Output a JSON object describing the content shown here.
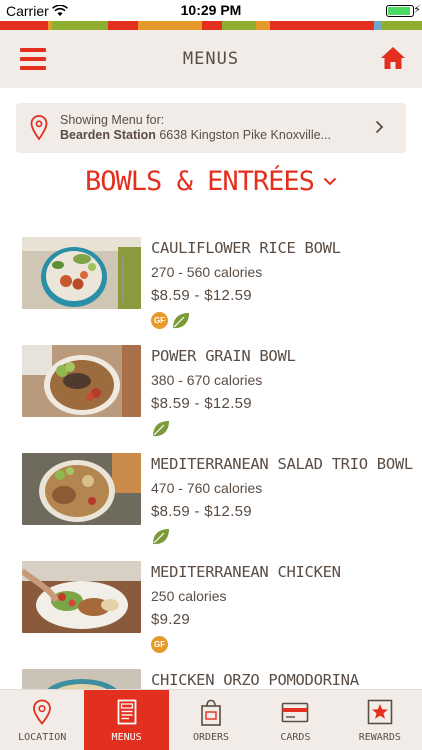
{
  "status_bar": {
    "carrier": "Carrier",
    "time": "10:29 PM",
    "battery_level": 0.9
  },
  "stripe_colors": [
    "#e3301e",
    "#e79a2c",
    "#8fae2f",
    "#e3301e",
    "#e79a2c",
    "#e3301e",
    "#8fae2f",
    "#e79a2c",
    "#e3301e",
    "#6fa9c9",
    "#8fae2f"
  ],
  "header": {
    "title": "MENUS"
  },
  "location": {
    "prefix": "Showing Menu for:",
    "name": "Bearden Station",
    "address": "6638 Kingston Pike Knoxville..."
  },
  "category": {
    "title": "BOWLS & ENTRÉES"
  },
  "items": [
    {
      "name": "CAULIFLOWER RICE BOWL",
      "calories": "270 - 560 calories",
      "price": "$8.59 - $12.59",
      "gf": "GF"
    },
    {
      "name": "POWER GRAIN BOWL",
      "calories": "380 - 670 calories",
      "price": "$8.59 - $12.59"
    },
    {
      "name": "MEDITERRANEAN SALAD TRIO BOWL",
      "calories": "470 - 760 calories",
      "price": "$8.59 - $12.59"
    },
    {
      "name": "MEDITERRANEAN CHICKEN",
      "calories": "250 calories",
      "price": "$9.29",
      "gf": "GF"
    },
    {
      "name": "CHICKEN ORZO POMODORINA"
    }
  ],
  "tabs": [
    {
      "label": "LOCATION",
      "icon": "location-pin-icon"
    },
    {
      "label": "MENUS",
      "icon": "menu-document-icon",
      "active": true
    },
    {
      "label": "ORDERS",
      "icon": "shopping-bag-icon"
    },
    {
      "label": "CARDS",
      "icon": "gift-card-icon"
    },
    {
      "label": "REWARDS",
      "icon": "star-icon"
    }
  ],
  "colors": {
    "accent": "#e3301e",
    "text": "#5b4d44",
    "header_bg": "#f1ece8",
    "gf": "#e79a2c",
    "veg": "#7a9a36"
  }
}
